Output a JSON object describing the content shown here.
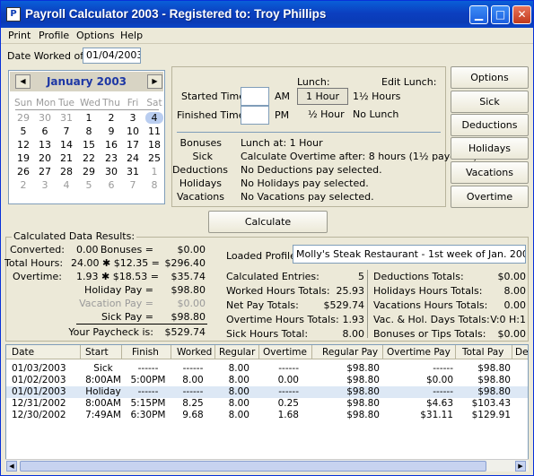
{
  "window": {
    "title": "Payroll Calculator 2003 - Registered to: Troy Phillips",
    "app_icon": "P"
  },
  "menu": [
    "Print",
    "Profile",
    "Options",
    "Help"
  ],
  "date_worked": {
    "label": "Date Worked of :",
    "value": "01/04/2003"
  },
  "calendar": {
    "month": "January 2003",
    "dow": [
      "Sun",
      "Mon",
      "Tue",
      "Wed",
      "Thu",
      "Fri",
      "Sat"
    ],
    "weeks": [
      [
        "29",
        "30",
        "31",
        "1",
        "2",
        "3",
        "4"
      ],
      [
        "5",
        "6",
        "7",
        "8",
        "9",
        "10",
        "11"
      ],
      [
        "12",
        "13",
        "14",
        "15",
        "16",
        "17",
        "18"
      ],
      [
        "19",
        "20",
        "21",
        "22",
        "23",
        "24",
        "25"
      ],
      [
        "26",
        "27",
        "28",
        "29",
        "30",
        "31",
        "1"
      ],
      [
        "2",
        "3",
        "4",
        "5",
        "6",
        "7",
        "8"
      ]
    ]
  },
  "time_entry": {
    "started_label": "Started Time:",
    "am": "AM",
    "started_value": "",
    "finished_label": "Finished Time:",
    "pm": "PM",
    "finished_value": "",
    "lunch_label": "Lunch:",
    "lunch_1hour": "1 Hour",
    "lunch_half": "½ Hour",
    "edit_lunch_label": "Edit Lunch:",
    "edit_lunch_1half": "1½ Hours",
    "edit_lunch_none": "No Lunch"
  },
  "summary": [
    {
      "label": "Bonuses",
      "value": "Lunch at: 1 Hour"
    },
    {
      "label": "Sick",
      "value": "Calculate Overtime after: 8 hours (1½ pay-rate)"
    },
    {
      "label": "Deductions",
      "value": "No Deductions pay selected."
    },
    {
      "label": "Holidays",
      "value": "No Holidays pay selected."
    },
    {
      "label": "Vacations",
      "value": "No Vacations pay selected."
    }
  ],
  "side_buttons": [
    "Options",
    "Sick",
    "Deductions",
    "Holidays",
    "Vacations",
    "Overtime"
  ],
  "calculate_label": "Calculate",
  "results": {
    "group_label": "Calculated Data Results:",
    "converted_label": "Converted:",
    "converted_value": "0.00",
    "bonuses_label": "Bonuses =",
    "bonuses_value": "$0.00",
    "total_hours_label": "Total Hours:",
    "total_hours_calc": "24.00  ✱ $12.35  =",
    "total_hours_value": "$296.40",
    "overtime_label": "Overtime:",
    "overtime_calc": "1.93  ✱ $18.53  =",
    "overtime_value": "$35.74",
    "holiday_label": "Holiday Pay =",
    "holiday_value": "$98.80",
    "vacation_label": "Vacation Pay =",
    "vacation_value": "$0.00",
    "sick_label": "Sick Pay =",
    "sick_value": "$98.80",
    "paycheck_label": "Your Paycheck is:",
    "paycheck_value": "$529.74"
  },
  "profile": {
    "label": "Loaded Profile:",
    "value": "Molly's Steak Restaurant - 1st week of Jan. 2003.dat"
  },
  "stats_left": [
    {
      "label": "Calculated Entries:",
      "value": "5"
    },
    {
      "label": "Worked Hours Totals:",
      "value": "25.93"
    },
    {
      "label": "Net Pay Totals:",
      "value": "$529.74"
    },
    {
      "label": "Overtime Hours Totals:",
      "value": "1.93"
    },
    {
      "label": "Sick Hours Total:",
      "value": "8.00"
    }
  ],
  "stats_right": [
    {
      "label": "Deductions Totals:",
      "value": "$0.00"
    },
    {
      "label": "Holidays Hours Totals:",
      "value": "8.00"
    },
    {
      "label": "Vacations Hours Totals:",
      "value": "0.00"
    },
    {
      "label": "Vac. & Hol. Days Totals:",
      "value": "V:0  H:1"
    },
    {
      "label": "Bonuses or Tips Totals:",
      "value": "$0.00"
    }
  ],
  "table": {
    "headers": [
      "Date",
      "Start",
      "Finish",
      "Worked",
      "Regular",
      "Overtime",
      "Regular Pay",
      "Overtime Pay",
      "Total Pay",
      "De"
    ],
    "rows": [
      [
        "01/03/2003",
        "Sick",
        "------",
        "------",
        "8.00",
        "------",
        "$98.80",
        "------",
        "$98.80"
      ],
      [
        "01/02/2003",
        "8:00AM",
        "5:00PM",
        "8.00",
        "8.00",
        "0.00",
        "$98.80",
        "$0.00",
        "$98.80"
      ],
      [
        "01/01/2003",
        "Holiday",
        "------",
        "------",
        "8.00",
        "------",
        "$98.80",
        "------",
        "$98.80"
      ],
      [
        "12/31/2002",
        "8:00AM",
        "5:15PM",
        "8.25",
        "8.00",
        "0.25",
        "$98.80",
        "$4.63",
        "$103.43"
      ],
      [
        "12/30/2002",
        "7:49AM",
        "6:30PM",
        "9.68",
        "8.00",
        "1.68",
        "$98.80",
        "$31.11",
        "$129.91"
      ]
    ]
  }
}
